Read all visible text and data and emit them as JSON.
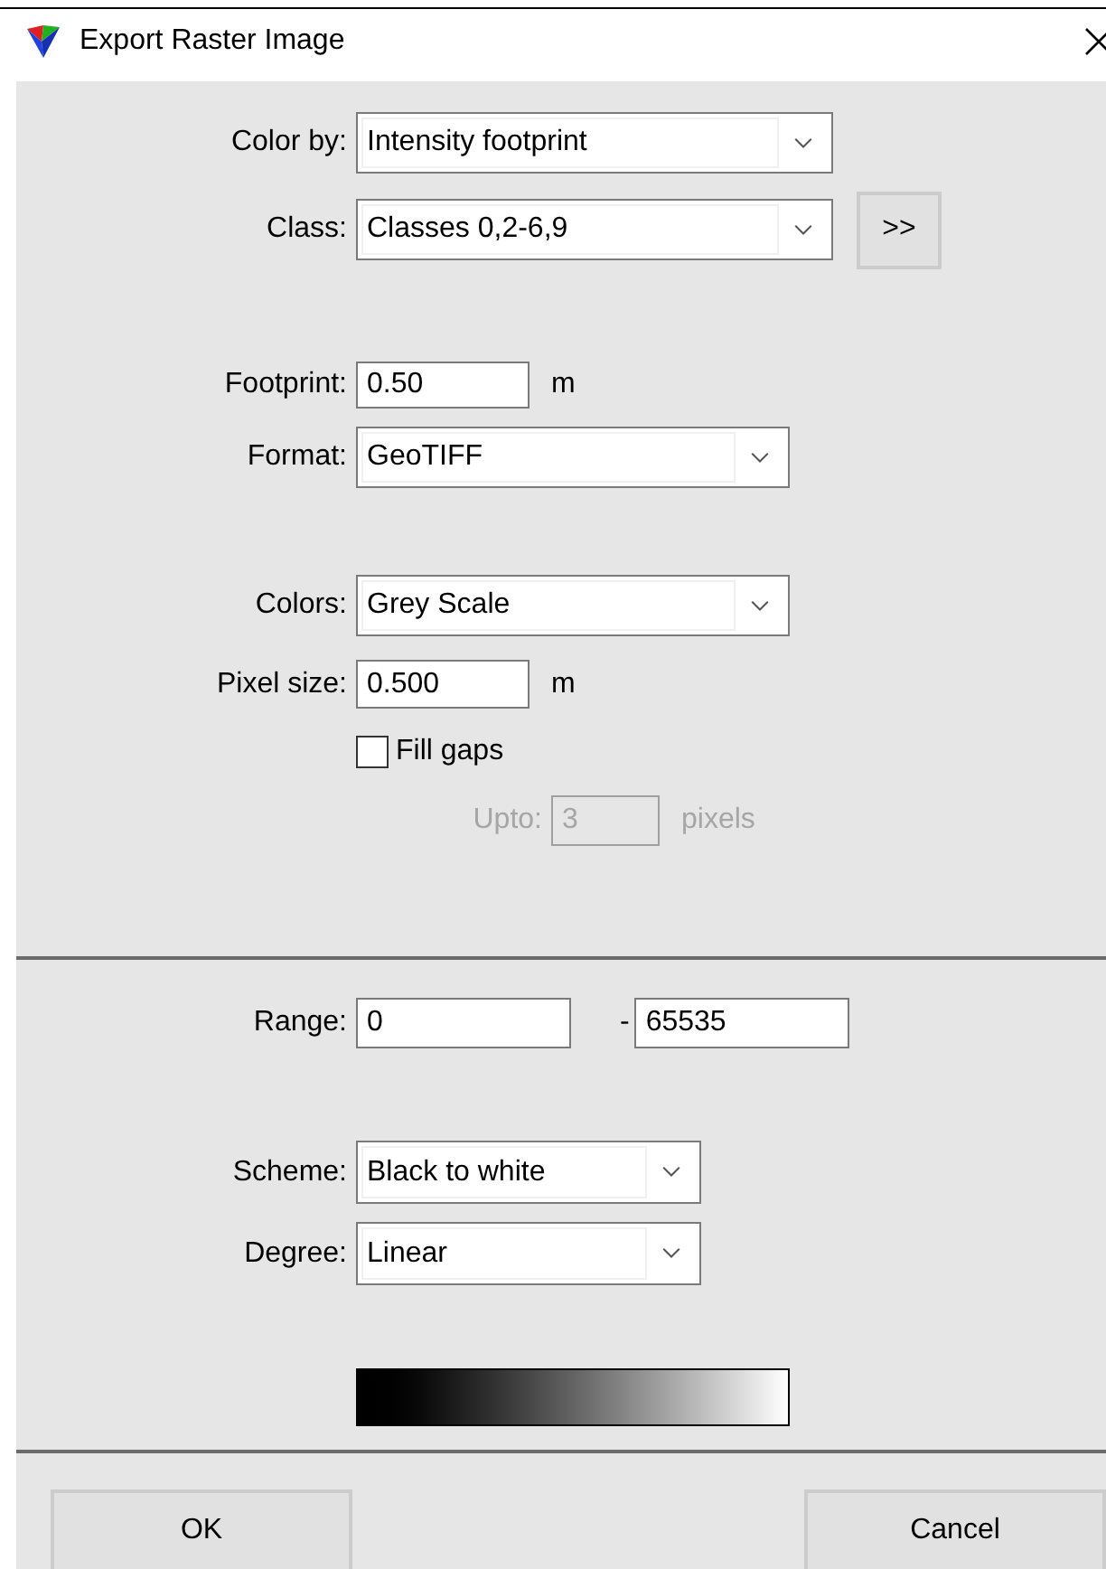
{
  "window": {
    "title": "Export Raster Image"
  },
  "sections": [
    {
      "fields": [
        {
          "kind": "dropdown",
          "label": "Color by:",
          "value": "Intensity footprint"
        },
        {
          "kind": "dropdown",
          "label": "Class:",
          "value": "Classes 0,2-6,9",
          "button": ">>"
        },
        {
          "kind": "number",
          "label": "Footprint:",
          "value": "0.50",
          "unit": "m",
          "disabled": false
        },
        {
          "kind": "dropdown",
          "label": "Format:",
          "value": "GeoTIFF"
        },
        {
          "kind": "dropdown",
          "label": "Colors:",
          "value": "Grey Scale"
        },
        {
          "kind": "number",
          "label": "Pixel size:",
          "value": "0.500",
          "unit": "m",
          "disabled": false
        },
        {
          "kind": "checkbox",
          "label": "Fill gaps",
          "checked": false
        },
        {
          "kind": "number",
          "label": "Upto:",
          "value": "3",
          "unit": "pixels",
          "disabled": true
        }
      ]
    },
    {
      "fields": [
        {
          "kind": "range",
          "label": "Range:",
          "from": "0",
          "separator": "-",
          "to": "65535"
        },
        {
          "kind": "dropdown",
          "label": "Scheme:",
          "value": "Black to white"
        },
        {
          "kind": "dropdown",
          "label": "Degree:",
          "value": "Linear"
        },
        {
          "kind": "gradient"
        }
      ]
    }
  ],
  "buttons": [
    "OK",
    "Cancel"
  ]
}
